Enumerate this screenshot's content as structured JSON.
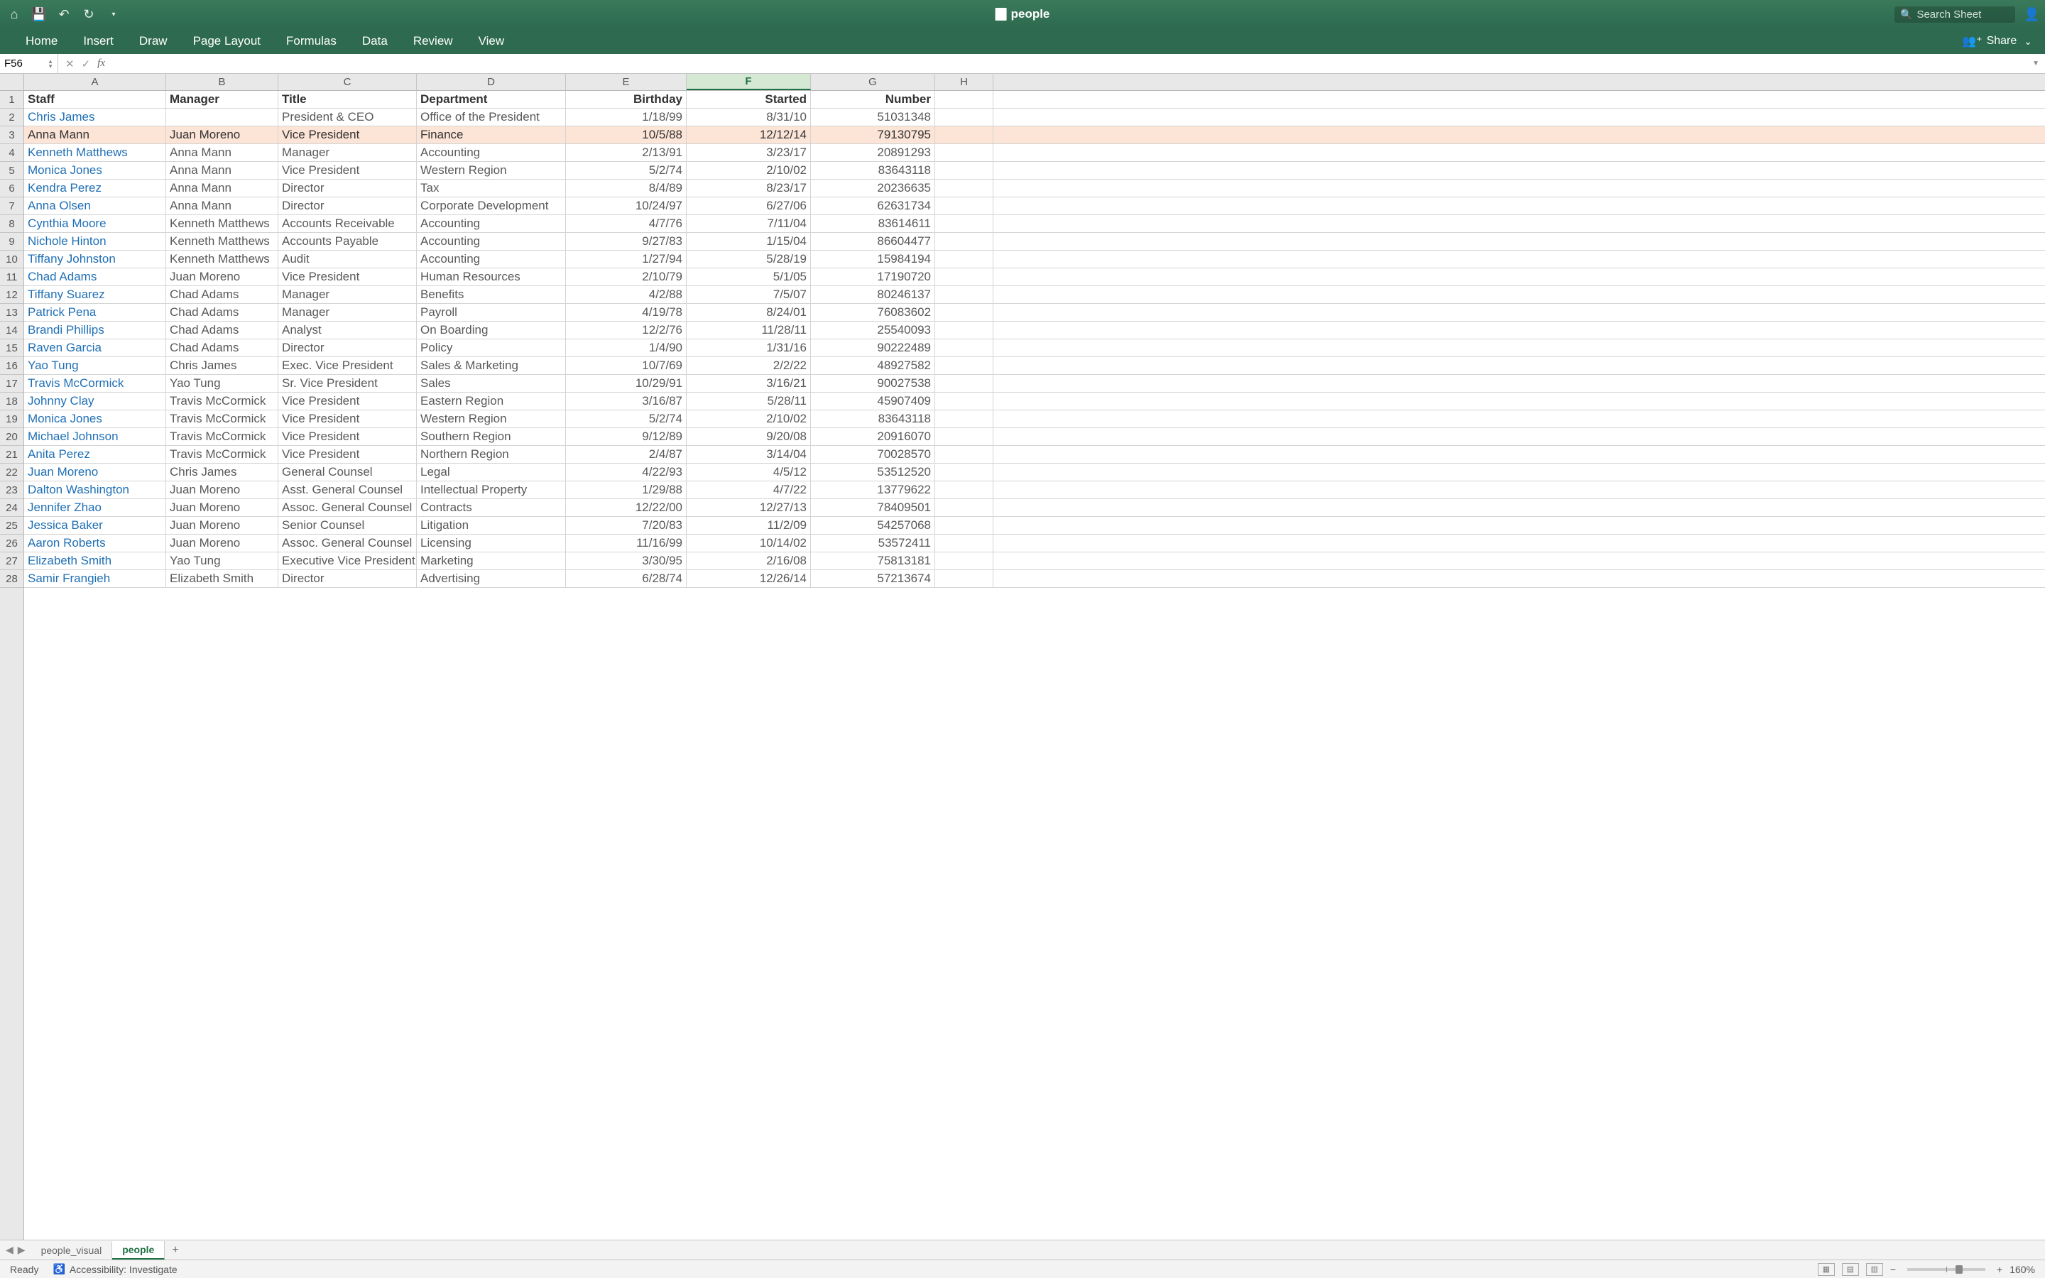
{
  "titlebar": {
    "doc_name": "people",
    "search_placeholder": "Search Sheet"
  },
  "ribbon": {
    "tabs": [
      "Home",
      "Insert",
      "Draw",
      "Page Layout",
      "Formulas",
      "Data",
      "Review",
      "View"
    ],
    "share_label": "Share"
  },
  "formula_bar": {
    "name_box": "F56",
    "formula": ""
  },
  "columns": [
    "A",
    "B",
    "C",
    "D",
    "E",
    "F",
    "G",
    "H"
  ],
  "selected_column": "F",
  "headers": {
    "A": "Staff",
    "B": "Manager",
    "C": "Title",
    "D": "Department",
    "E": "Birthday",
    "F": "Started",
    "G": "Number"
  },
  "rows": [
    {
      "n": 1,
      "hdr": true
    },
    {
      "n": 2,
      "A": "Chris James",
      "B": "",
      "C": "President & CEO",
      "D": "Office of the President",
      "E": "1/18/99",
      "F": "8/31/10",
      "G": "51031348"
    },
    {
      "n": 3,
      "hl": true,
      "A": "Anna Mann",
      "B": "Juan Moreno",
      "C": "Vice President",
      "D": "Finance",
      "E": "10/5/88",
      "F": "12/12/14",
      "G": "79130795"
    },
    {
      "n": 4,
      "A": "Kenneth Matthews",
      "B": "Anna Mann",
      "C": "Manager",
      "D": "Accounting",
      "E": "2/13/91",
      "F": "3/23/17",
      "G": "20891293"
    },
    {
      "n": 5,
      "A": "Monica Jones",
      "B": "Anna Mann",
      "C": "Vice President",
      "D": "Western Region",
      "E": "5/2/74",
      "F": "2/10/02",
      "G": "83643118"
    },
    {
      "n": 6,
      "A": "Kendra Perez",
      "B": "Anna Mann",
      "C": "Director",
      "D": "Tax",
      "E": "8/4/89",
      "F": "8/23/17",
      "G": "20236635"
    },
    {
      "n": 7,
      "A": "Anna Olsen",
      "B": "Anna Mann",
      "C": "Director",
      "D": "Corporate Development",
      "E": "10/24/97",
      "F": "6/27/06",
      "G": "62631734"
    },
    {
      "n": 8,
      "A": "Cynthia Moore",
      "B": "Kenneth Matthews",
      "C": "Accounts Receivable",
      "D": "Accounting",
      "E": "4/7/76",
      "F": "7/11/04",
      "G": "83614611"
    },
    {
      "n": 9,
      "A": "Nichole Hinton",
      "B": "Kenneth Matthews",
      "C": "Accounts Payable",
      "D": "Accounting",
      "E": "9/27/83",
      "F": "1/15/04",
      "G": "86604477"
    },
    {
      "n": 10,
      "A": "Tiffany Johnston",
      "B": "Kenneth Matthews",
      "C": "Audit",
      "D": "Accounting",
      "E": "1/27/94",
      "F": "5/28/19",
      "G": "15984194"
    },
    {
      "n": 11,
      "A": "Chad Adams",
      "B": "Juan Moreno",
      "C": "Vice President",
      "D": "Human Resources",
      "E": "2/10/79",
      "F": "5/1/05",
      "G": "17190720"
    },
    {
      "n": 12,
      "A": "Tiffany Suarez",
      "B": "Chad Adams",
      "C": "Manager",
      "D": "Benefits",
      "E": "4/2/88",
      "F": "7/5/07",
      "G": "80246137"
    },
    {
      "n": 13,
      "A": "Patrick Pena",
      "B": "Chad Adams",
      "C": "Manager",
      "D": "Payroll",
      "E": "4/19/78",
      "F": "8/24/01",
      "G": "76083602"
    },
    {
      "n": 14,
      "A": "Brandi Phillips",
      "B": "Chad Adams",
      "C": "Analyst",
      "D": "On Boarding",
      "E": "12/2/76",
      "F": "11/28/11",
      "G": "25540093"
    },
    {
      "n": 15,
      "A": "Raven Garcia",
      "B": "Chad Adams",
      "C": "Director",
      "D": "Policy",
      "E": "1/4/90",
      "F": "1/31/16",
      "G": "90222489"
    },
    {
      "n": 16,
      "A": "Yao Tung",
      "B": "Chris James",
      "C": "Exec. Vice President",
      "D": "Sales & Marketing",
      "E": "10/7/69",
      "F": "2/2/22",
      "G": "48927582"
    },
    {
      "n": 17,
      "A": "Travis McCormick",
      "B": "Yao Tung",
      "C": "Sr. Vice President",
      "D": "Sales",
      "E": "10/29/91",
      "F": "3/16/21",
      "G": "90027538"
    },
    {
      "n": 18,
      "A": "Johnny Clay",
      "B": "Travis McCormick",
      "C": "Vice President",
      "D": "Eastern Region",
      "E": "3/16/87",
      "F": "5/28/11",
      "G": "45907409"
    },
    {
      "n": 19,
      "A": "Monica Jones",
      "B": "Travis McCormick",
      "C": "Vice President",
      "D": "Western Region",
      "E": "5/2/74",
      "F": "2/10/02",
      "G": "83643118"
    },
    {
      "n": 20,
      "A": "Michael Johnson",
      "B": "Travis McCormick",
      "C": "Vice President",
      "D": "Southern Region",
      "E": "9/12/89",
      "F": "9/20/08",
      "G": "20916070"
    },
    {
      "n": 21,
      "A": "Anita Perez",
      "B": "Travis McCormick",
      "C": "Vice President",
      "D": "Northern Region",
      "E": "2/4/87",
      "F": "3/14/04",
      "G": "70028570"
    },
    {
      "n": 22,
      "A": "Juan Moreno",
      "B": "Chris James",
      "C": "General Counsel",
      "D": "Legal",
      "E": "4/22/93",
      "F": "4/5/12",
      "G": "53512520"
    },
    {
      "n": 23,
      "A": "Dalton Washington",
      "B": "Juan Moreno",
      "C": "Asst. General Counsel",
      "D": "Intellectual Property",
      "E": "1/29/88",
      "F": "4/7/22",
      "G": "13779622"
    },
    {
      "n": 24,
      "A": "Jennifer Zhao",
      "B": "Juan Moreno",
      "C": "Assoc. General Counsel",
      "D": "Contracts",
      "E": "12/22/00",
      "F": "12/27/13",
      "G": "78409501"
    },
    {
      "n": 25,
      "A": "Jessica Baker",
      "B": "Juan Moreno",
      "C": "Senior Counsel",
      "D": "Litigation",
      "E": "7/20/83",
      "F": "11/2/09",
      "G": "54257068"
    },
    {
      "n": 26,
      "A": "Aaron Roberts",
      "B": "Juan Moreno",
      "C": "Assoc. General Counsel",
      "D": "Licensing",
      "E": "11/16/99",
      "F": "10/14/02",
      "G": "53572411"
    },
    {
      "n": 27,
      "A": "Elizabeth Smith",
      "B": "Yao Tung",
      "C": "Executive Vice President",
      "D": "Marketing",
      "E": "3/30/95",
      "F": "2/16/08",
      "G": "75813181"
    },
    {
      "n": 28,
      "A": "Samir Frangieh",
      "B": "Elizabeth Smith",
      "C": "Director",
      "D": "Advertising",
      "E": "6/28/74",
      "F": "12/26/14",
      "G": "57213674"
    }
  ],
  "sheet_tabs": {
    "tabs": [
      "people_visual",
      "people"
    ],
    "active": "people"
  },
  "status": {
    "ready": "Ready",
    "accessibility": "Accessibility: Investigate",
    "zoom": "160%"
  }
}
